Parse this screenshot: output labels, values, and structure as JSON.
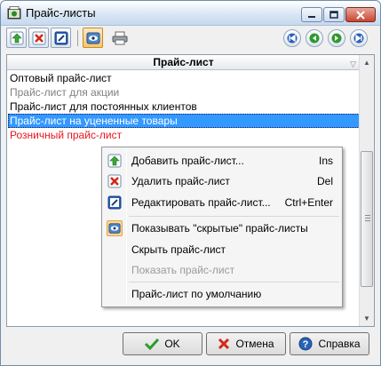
{
  "window": {
    "title": "Прайс-листы"
  },
  "toolbar": {
    "buttons": [
      {
        "icon": "add-icon"
      },
      {
        "icon": "delete-icon"
      },
      {
        "icon": "edit-icon"
      },
      {
        "icon": "eye-icon",
        "active": true
      },
      {
        "icon": "printer-icon"
      }
    ],
    "nav": [
      "first-icon",
      "prev-icon",
      "next-icon",
      "last-icon"
    ]
  },
  "list": {
    "header": "Прайс-лист",
    "rows": [
      {
        "label": "Оптовый прайс-лист",
        "color": "#000000"
      },
      {
        "label": "Прайс-лист для акции",
        "color": "#808080"
      },
      {
        "label": "Прайс-лист для постоянных клиентов",
        "color": "#000000"
      },
      {
        "label": "Прайс-лист на уцененные товары",
        "color": "#ffffff",
        "selected": true
      },
      {
        "label": "Розничный прайс-лист",
        "color": "#e8141e"
      }
    ]
  },
  "menu": {
    "items": [
      {
        "label": "Добавить прайс-лист...",
        "shortcut": "Ins",
        "icon": "add-icon"
      },
      {
        "label": "Удалить прайс-лист",
        "shortcut": "Del",
        "icon": "delete-icon"
      },
      {
        "label": "Редактировать прайс-лист...",
        "shortcut": "Ctrl+Enter",
        "icon": "edit-icon"
      },
      {
        "label": "Показывать \"скрытые\" прайс-листы",
        "shortcut": "",
        "icon": "eye-icon",
        "checked": true
      },
      {
        "label": "Скрыть прайс-лист",
        "shortcut": ""
      },
      {
        "label": "Показать прайс-лист",
        "shortcut": "",
        "disabled": true
      },
      {
        "label": "Прайс-лист по умолчанию",
        "shortcut": ""
      }
    ]
  },
  "footer": {
    "ok_label": "OK",
    "cancel_label": "Отмена",
    "help_label": "Справка"
  },
  "colors": {
    "selection": "#3399ff",
    "accent": "#2a62b8"
  }
}
